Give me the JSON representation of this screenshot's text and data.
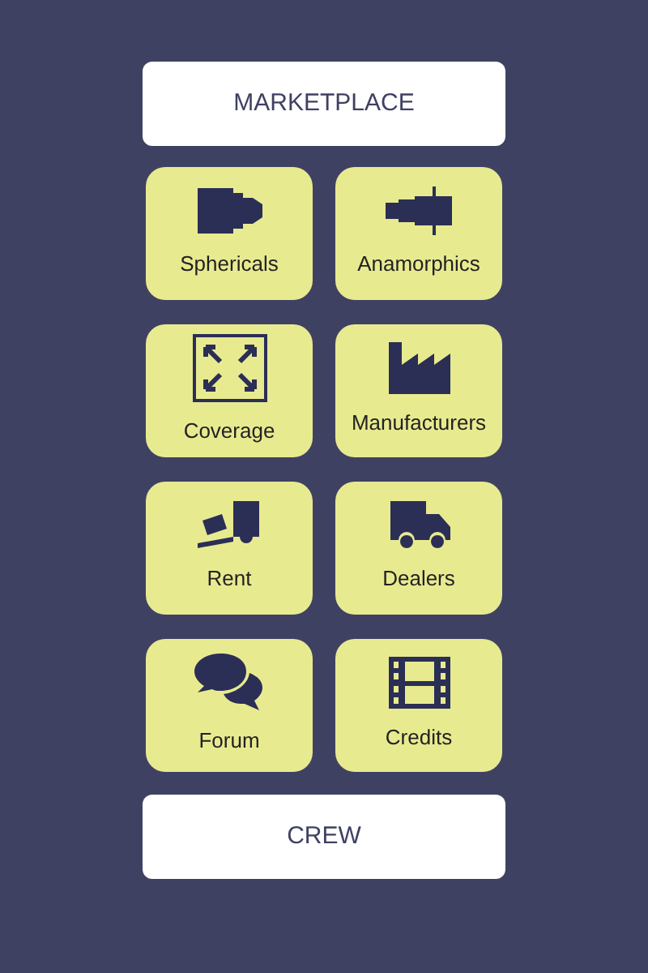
{
  "top_button": "MARKETPLACE",
  "tiles": [
    {
      "label": "Sphericals"
    },
    {
      "label": "Anamorphics"
    },
    {
      "label": "Coverage"
    },
    {
      "label": "Manufacturers"
    },
    {
      "label": "Rent"
    },
    {
      "label": "Dealers"
    },
    {
      "label": "Forum"
    },
    {
      "label": "Credits"
    }
  ],
  "bottom_button": "CREW"
}
